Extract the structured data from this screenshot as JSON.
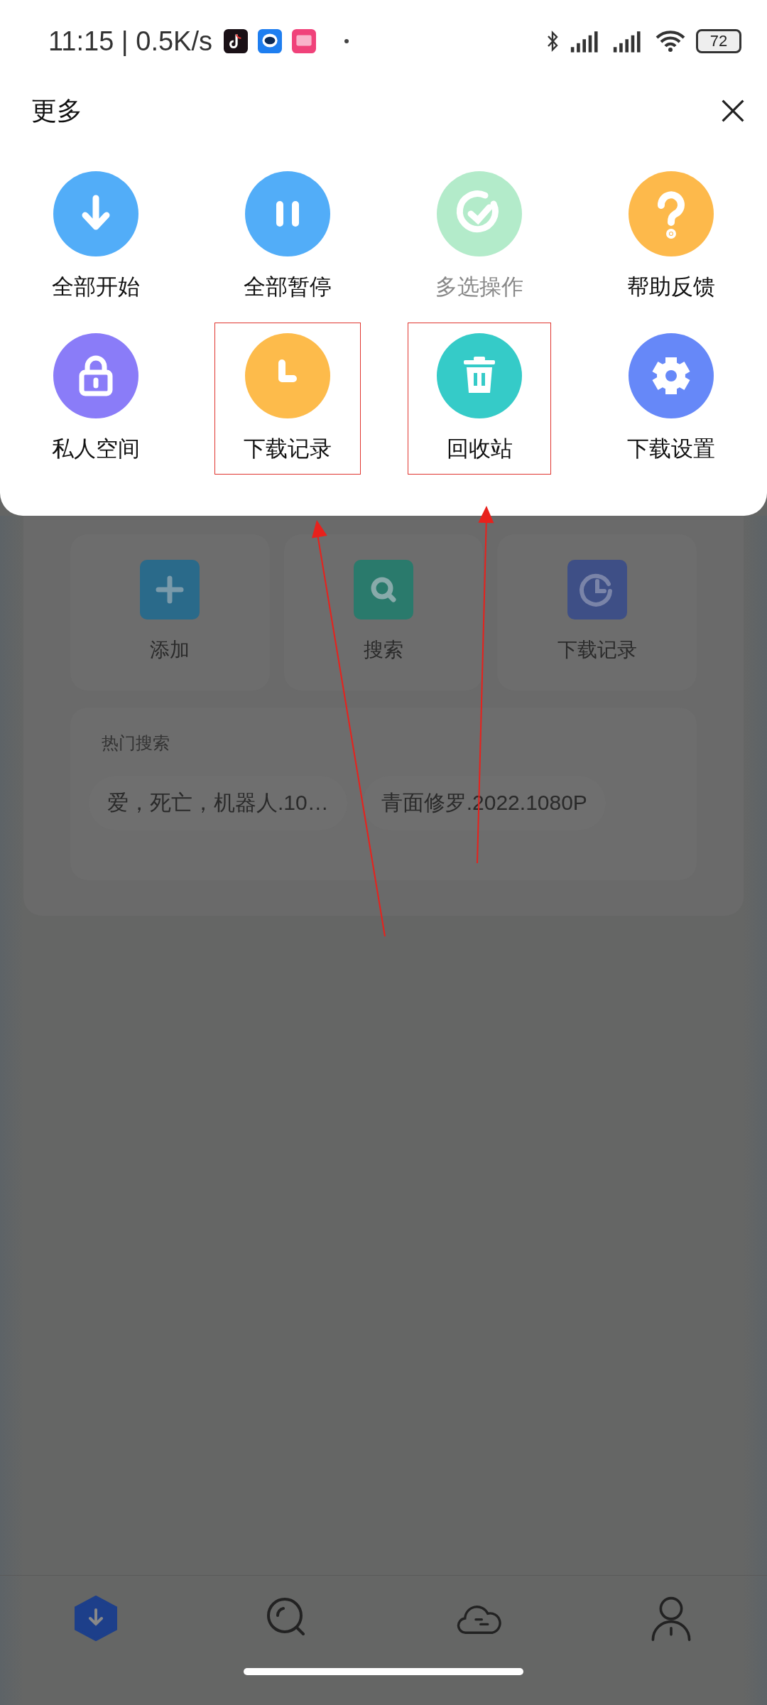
{
  "status_bar": {
    "time": "11:15 | 0.5K/s",
    "battery": "72"
  },
  "sheet": {
    "title": "更多",
    "items": [
      {
        "label": "全部开始",
        "kind": "download",
        "color": "#52adf8",
        "disabled": false,
        "highlighted": false
      },
      {
        "label": "全部暂停",
        "kind": "pause",
        "color": "#52adf8",
        "disabled": false,
        "highlighted": false
      },
      {
        "label": "多选操作",
        "kind": "check",
        "color": "#b3ebca",
        "disabled": true,
        "highlighted": false
      },
      {
        "label": "帮助反馈",
        "kind": "help",
        "color": "#fdb94b",
        "disabled": false,
        "highlighted": false
      },
      {
        "label": "私人空间",
        "kind": "lock",
        "color": "#8a7cf8",
        "disabled": false,
        "highlighted": false
      },
      {
        "label": "下载记录",
        "kind": "clock",
        "color": "#fdbb4b",
        "disabled": false,
        "highlighted": true
      },
      {
        "label": "回收站",
        "kind": "trash",
        "color": "#35cbc8",
        "disabled": false,
        "highlighted": true
      },
      {
        "label": "下载设置",
        "kind": "gear",
        "color": "#6688f8",
        "disabled": false,
        "highlighted": false
      }
    ]
  },
  "background": {
    "tiles": [
      {
        "label": "添加",
        "kind": "plus"
      },
      {
        "label": "搜索",
        "kind": "search"
      },
      {
        "label": "下载记录",
        "kind": "clock"
      }
    ],
    "hot_search": {
      "title": "热门搜索",
      "chips": [
        "爱，死亡，机器人.10…",
        "青面修罗.2022.1080P"
      ]
    }
  },
  "nav": [
    {
      "kind": "download",
      "selected": true
    },
    {
      "kind": "search",
      "selected": false
    },
    {
      "kind": "cloud",
      "selected": false
    },
    {
      "kind": "user",
      "selected": false
    }
  ]
}
